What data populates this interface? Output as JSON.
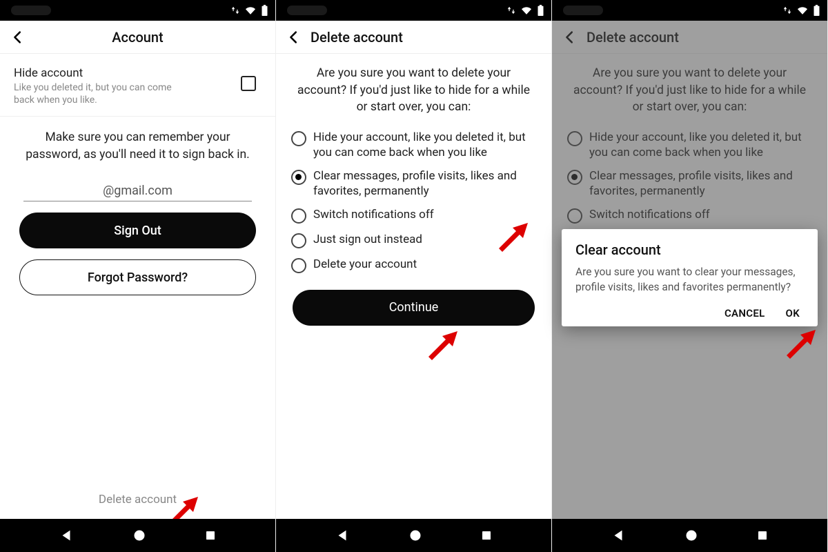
{
  "screen1": {
    "title": "Account",
    "hide_title": "Hide account",
    "hide_sub": "Like you deleted it, but you can come back when you like.",
    "remember": "Make sure you can remember your password, as you'll need it to sign back in.",
    "email": "@gmail.com",
    "signout": "Sign Out",
    "forgot": "Forgot Password?",
    "delete_link": "Delete account"
  },
  "screen2": {
    "title": "Delete account",
    "prompt": "Are you sure you want to delete your account? If you'd just like to hide for a while or start over, you can:",
    "options": [
      "Hide your account, like you deleted it, but you can come back when you like",
      "Clear messages, profile visits, likes and favorites, permanently",
      "Switch notifications off",
      "Just sign out instead",
      "Delete your account"
    ],
    "continue": "Continue"
  },
  "screen3": {
    "title": "Delete account",
    "prompt": "Are you sure you want to delete your account? If you'd just like to hide for a while or start over, you can:",
    "options": [
      "Hide your account, like you deleted it, but you can come back when you like",
      "Clear messages, profile visits, likes and favorites, permanently",
      "Switch notifications off"
    ],
    "modal": {
      "title": "Clear account",
      "body": "Are you sure you want to clear your messages, profile visits, likes and favorites permanently?",
      "cancel": "CANCEL",
      "ok": "OK"
    }
  }
}
